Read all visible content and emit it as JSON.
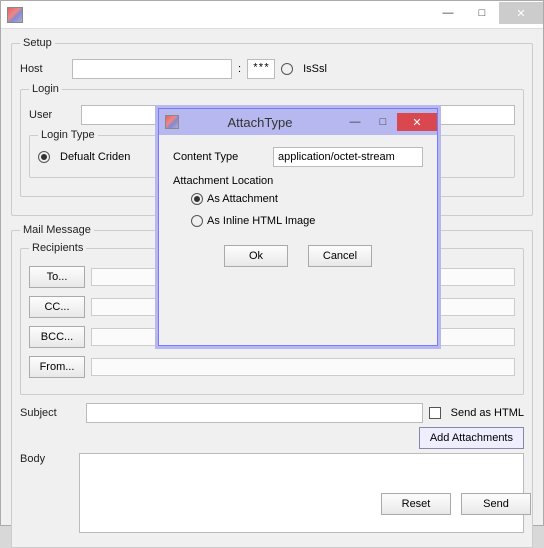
{
  "main": {
    "buttons": {
      "minimize": "—",
      "maximize": "□",
      "close": "✕"
    }
  },
  "setup": {
    "legend": "Setup",
    "host_label": "Host",
    "host_value": "",
    "colon": ":",
    "port_value": "***",
    "isssl_label": "IsSsl",
    "login": {
      "legend": "Login",
      "user_label": "User",
      "user_value": "",
      "login_type_legend": "Login Type",
      "default_cred_label": "Defualt Criden"
    }
  },
  "mail": {
    "legend": "Mail Message",
    "recipients_legend": "Recipients",
    "to_btn": "To...",
    "cc_btn": "CC...",
    "bcc_btn": "BCC...",
    "from_btn": "From...",
    "subject_label": "Subject",
    "subject_value": "",
    "send_html_label": "Send as HTML",
    "add_attach_label": "Add Attachments",
    "body_label": "Body",
    "body_value": ""
  },
  "footer": {
    "reset": "Reset",
    "send": "Send"
  },
  "dialog": {
    "title": "AttachType",
    "buttons": {
      "minimize": "—",
      "maximize": "□",
      "close": "✕"
    },
    "content_type_label": "Content Type",
    "content_type_value": "application/octet-stream",
    "attach_loc_label": "Attachment Location",
    "as_attachment": "As Attachment",
    "as_inline": "As Inline HTML Image",
    "ok": "Ok",
    "cancel": "Cancel"
  }
}
